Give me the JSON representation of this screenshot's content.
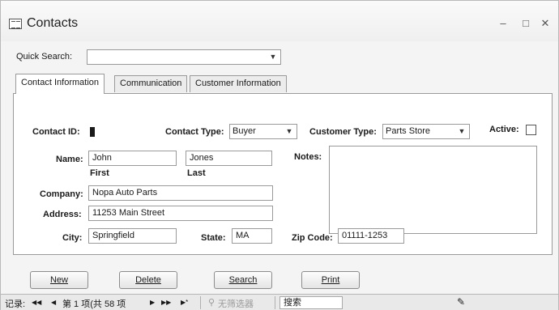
{
  "window": {
    "title": "Contacts"
  },
  "quick_search": {
    "label": "Quick Search:",
    "value": ""
  },
  "tabs": [
    {
      "label": "Contact Information",
      "active": true
    },
    {
      "label": "Communication",
      "active": false
    },
    {
      "label": "Customer Information",
      "active": false
    }
  ],
  "form": {
    "contact_id": {
      "label": "Contact ID:"
    },
    "contact_type": {
      "label": "Contact Type:",
      "value": "Buyer"
    },
    "customer_type": {
      "label": "Customer Type:",
      "value": "Parts Store"
    },
    "active": {
      "label": "Active:",
      "checked": false
    },
    "name": {
      "label": "Name:",
      "first": "John",
      "last": "Jones",
      "first_caption": "First",
      "last_caption": "Last"
    },
    "notes": {
      "label": "Notes:",
      "value": ""
    },
    "company": {
      "label": "Company:",
      "value": "Nopa Auto Parts"
    },
    "address": {
      "label": "Address:",
      "value": "11253 Main Street"
    },
    "city": {
      "label": "City:",
      "value": "Springfield"
    },
    "state": {
      "label": "State:",
      "value": "MA"
    },
    "zip": {
      "label": "Zip Code:",
      "value": "01111-1253"
    }
  },
  "buttons": {
    "new": "New",
    "delete": "Delete",
    "search": "Search",
    "print": "Print"
  },
  "navbar": {
    "record_label": "记录:",
    "first": "◀◀",
    "prev": "◀",
    "position": "第 1 项(共 58 项",
    "next": "▶",
    "last": "▶▶",
    "new_record": "▶*",
    "filter": "无筛选器",
    "search": "搜索"
  },
  "colors": {
    "accent": "#1a1a1a",
    "background": "#f4f4f4"
  }
}
